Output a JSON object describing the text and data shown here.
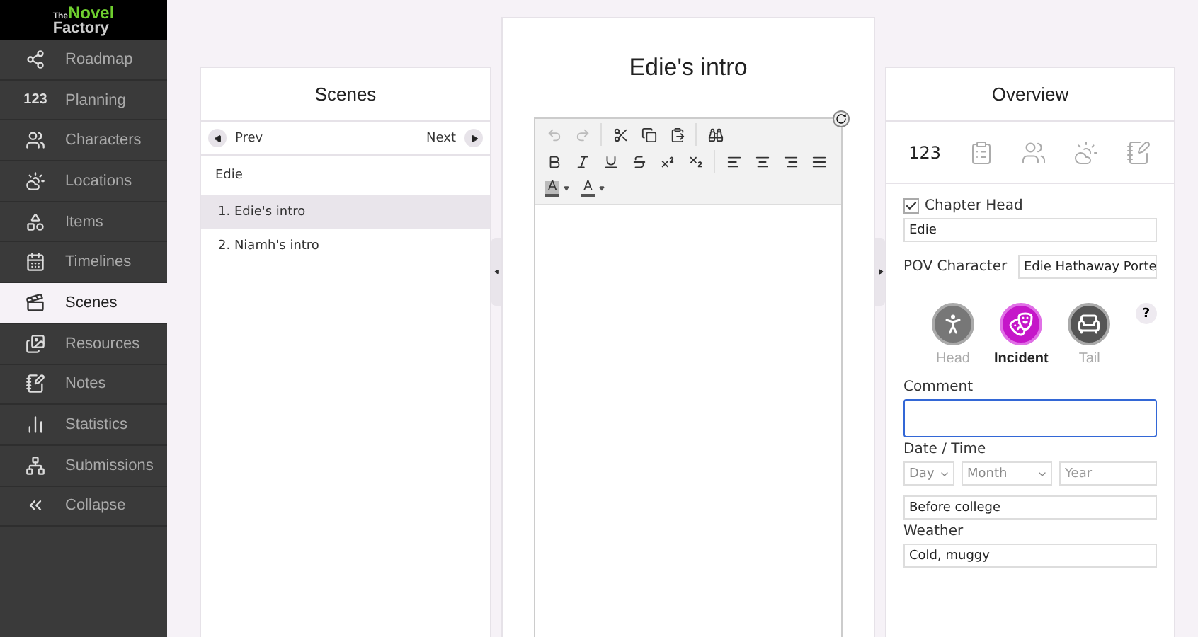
{
  "sidebar": {
    "logo": {
      "small": "The",
      "top": "Novel",
      "bottom": "Factory"
    },
    "items": [
      {
        "label": "Roadmap",
        "selected": false
      },
      {
        "label": "Planning",
        "glyph": "123",
        "selected": false
      },
      {
        "label": "Characters",
        "selected": false
      },
      {
        "label": "Locations",
        "selected": false
      },
      {
        "label": "Items",
        "selected": false
      },
      {
        "label": "Timelines",
        "selected": false
      },
      {
        "label": "Scenes",
        "selected": true
      },
      {
        "label": "Resources",
        "selected": false
      },
      {
        "label": "Notes",
        "selected": false
      },
      {
        "label": "Statistics",
        "selected": false
      },
      {
        "label": "Submissions",
        "selected": false
      },
      {
        "label": "Collapse",
        "selected": false
      }
    ]
  },
  "scenes": {
    "title": "Scenes",
    "prev": "Prev",
    "next": "Next",
    "chapter": "Edie",
    "items": [
      {
        "label": "1. Edie's intro",
        "selected": true
      },
      {
        "label": "2. Niamh's intro",
        "selected": false
      }
    ]
  },
  "editor": {
    "title": "Edie's intro",
    "undo": {
      "disabled": true
    },
    "redo": {
      "disabled": true
    },
    "color_buttons": [
      {
        "label": "A",
        "kind": "highlight"
      },
      {
        "label": "A",
        "kind": "text"
      }
    ]
  },
  "overview": {
    "title": "Overview",
    "tabs": [
      {
        "glyph": "123",
        "selected": true
      },
      {
        "selected": false
      },
      {
        "selected": false
      },
      {
        "selected": false
      },
      {
        "selected": false
      }
    ],
    "chapter_head": {
      "label": "Chapter Head",
      "checked": true,
      "value": "Edie"
    },
    "pov": {
      "label": "POV Character",
      "value": "Edie Hathaway Porte"
    },
    "help": "?",
    "stages": [
      {
        "label": "Head",
        "selected": false
      },
      {
        "label": "Incident",
        "selected": true
      },
      {
        "label": "Tail",
        "selected": false
      }
    ],
    "comment": {
      "label": "Comment"
    },
    "date": {
      "label": "Date / Time",
      "day": "Day",
      "month": "Month",
      "year_placeholder": "Year",
      "value": "Before college"
    },
    "weather": {
      "label": "Weather",
      "value": "Cold, muggy"
    }
  }
}
